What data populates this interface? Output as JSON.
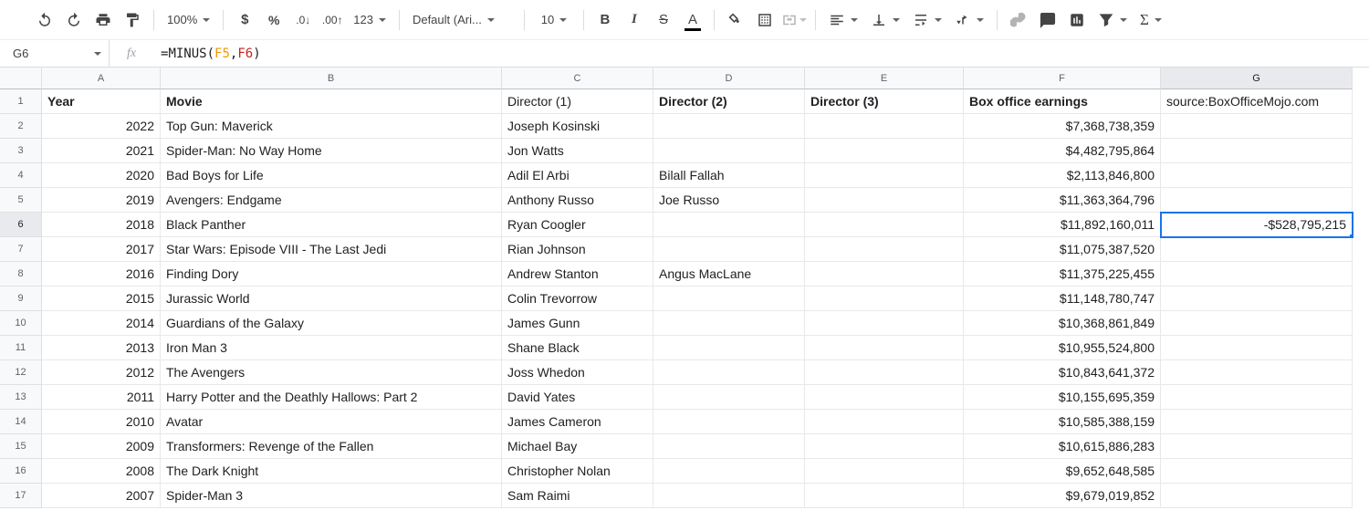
{
  "toolbar": {
    "zoom": "100%",
    "font": "Default (Ari...",
    "font_size": "10",
    "number_format": "123"
  },
  "formula_bar": {
    "name_box": "G6",
    "fx": "fx",
    "eq": "=",
    "fn": "MINUS",
    "open": "(",
    "ref1": "F5",
    "comma": ", ",
    "ref2": "F6",
    "close": ")"
  },
  "columns": [
    "A",
    "B",
    "C",
    "D",
    "E",
    "F",
    "G"
  ],
  "header": {
    "A": "Year",
    "B": "Movie",
    "C": "Director (1)",
    "D": "Director (2)",
    "E": "Director (3)",
    "F": "Box office earnings",
    "G_prefix": "source: ",
    "G_link": "BoxOfficeMojo.com"
  },
  "rows": [
    {
      "n": "2",
      "A": "2022",
      "B": "Top Gun: Maverick",
      "C": "Joseph Kosinski",
      "D": "",
      "E": "",
      "F": "$7,368,738,359",
      "G": ""
    },
    {
      "n": "3",
      "A": "2021",
      "B": "Spider-Man: No Way Home",
      "C": "Jon Watts",
      "D": "",
      "E": "",
      "F": "$4,482,795,864",
      "G": ""
    },
    {
      "n": "4",
      "A": "2020",
      "B": "Bad Boys for Life",
      "C": "Adil El Arbi",
      "D": "Bilall Fallah",
      "E": "",
      "F": "$2,113,846,800",
      "G": ""
    },
    {
      "n": "5",
      "A": "2019",
      "B": "Avengers: Endgame",
      "C": "Anthony Russo",
      "D": "Joe Russo",
      "E": "",
      "F": "$11,363,364,796",
      "G": ""
    },
    {
      "n": "6",
      "A": "2018",
      "B": "Black Panther",
      "C": "Ryan Coogler",
      "D": "",
      "E": "",
      "F": "$11,892,160,011",
      "G": "-$528,795,215"
    },
    {
      "n": "7",
      "A": "2017",
      "B": "Star Wars: Episode VIII - The Last Jedi",
      "C": "Rian Johnson",
      "D": "",
      "E": "",
      "F": "$11,075,387,520",
      "G": ""
    },
    {
      "n": "8",
      "A": "2016",
      "B": "Finding Dory",
      "C": "Andrew Stanton",
      "D": "Angus MacLane",
      "E": "",
      "F": "$11,375,225,455",
      "G": ""
    },
    {
      "n": "9",
      "A": "2015",
      "B": "Jurassic World",
      "C": "Colin Trevorrow",
      "D": "",
      "E": "",
      "F": "$11,148,780,747",
      "G": ""
    },
    {
      "n": "10",
      "A": "2014",
      "B": "Guardians of the Galaxy",
      "C": "James Gunn",
      "D": "",
      "E": "",
      "F": "$10,368,861,849",
      "G": ""
    },
    {
      "n": "11",
      "A": "2013",
      "B": "Iron Man 3",
      "C": "Shane Black",
      "D": "",
      "E": "",
      "F": "$10,955,524,800",
      "G": ""
    },
    {
      "n": "12",
      "A": "2012",
      "B": "The Avengers",
      "C": "Joss Whedon",
      "D": "",
      "E": "",
      "F": "$10,843,641,372",
      "G": ""
    },
    {
      "n": "13",
      "A": "2011",
      "B": "Harry Potter and the Deathly Hallows: Part 2",
      "C": "David Yates",
      "D": "",
      "E": "",
      "F": "$10,155,695,359",
      "G": ""
    },
    {
      "n": "14",
      "A": "2010",
      "B": "Avatar",
      "C": "James Cameron",
      "D": "",
      "E": "",
      "F": "$10,585,388,159",
      "G": ""
    },
    {
      "n": "15",
      "A": "2009",
      "B": "Transformers: Revenge of the Fallen",
      "C": "Michael Bay",
      "D": "",
      "E": "",
      "F": "$10,615,886,283",
      "G": ""
    },
    {
      "n": "16",
      "A": "2008",
      "B": "The Dark Knight",
      "C": "Christopher Nolan",
      "D": "",
      "E": "",
      "F": "$9,652,648,585",
      "G": ""
    },
    {
      "n": "17",
      "A": "2007",
      "B": "Spider-Man 3",
      "C": "Sam Raimi",
      "D": "",
      "E": "",
      "F": "$9,679,019,852",
      "G": ""
    }
  ],
  "active_cell": "G6"
}
